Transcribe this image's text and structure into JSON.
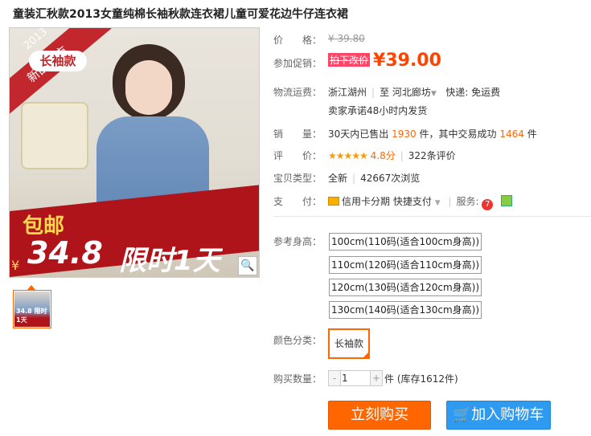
{
  "title": "童装汇秋款2013女童纯棉长袖秋款连衣裙儿童可爱花边牛仔连衣裙",
  "image": {
    "corner_year": "2013",
    "corner_new": "新品上市",
    "corner_long": "长袖款",
    "promo_free_shipping": "包邮",
    "promo_price": "34.8",
    "promo_limited": "限时1天",
    "yen_mark": "¥",
    "thumb_text": "34.8 限时1天"
  },
  "price": {
    "label": "价　　格：",
    "value": "¥ 39.80"
  },
  "promo": {
    "label": "参加促销：",
    "tag": "拍下改价",
    "value": "¥39.00"
  },
  "shipping": {
    "label": "物流运费：",
    "from": "浙江湖州",
    "to_word": "至",
    "to": "河北廊坊",
    "express": "快递: 免运费",
    "promise": "卖家承诺48小时内发货"
  },
  "sales": {
    "label": "销　　量：",
    "prefix": "30天内已售出",
    "sold": "1930",
    "unit1": "件，其中交易成功",
    "success": "1464",
    "unit2": "件"
  },
  "rating": {
    "label": "评　　价：",
    "stars": "★★★★★",
    "score": "4.8分",
    "count": "322条评价"
  },
  "type": {
    "label": "宝贝类型：",
    "value": "全新",
    "views": "42667次浏览"
  },
  "payment": {
    "label": "支　　付：",
    "credit": "信用卡分期",
    "quick": "快捷支付",
    "service_label": "服务:"
  },
  "sizes": {
    "label": "参考身高：",
    "options": [
      "100cm(110码(适合100cm身高))",
      "110cm(120码(适合110cm身高))",
      "120cm(130码(适合120cm身高))",
      "130cm(140码(适合130cm身高))"
    ]
  },
  "colors": {
    "label": "颜色分类：",
    "options": [
      "长袖款"
    ]
  },
  "quantity": {
    "label": "购买数量：",
    "value": "1",
    "minus": "-",
    "plus": "+",
    "stock": "件 (库存1612件)"
  },
  "buttons": {
    "buy": "立刻购买",
    "cart": "加入购物车"
  },
  "accent": {
    "orange": "#ff6600",
    "blue": "#2e9af0",
    "red": "#b0141b"
  }
}
